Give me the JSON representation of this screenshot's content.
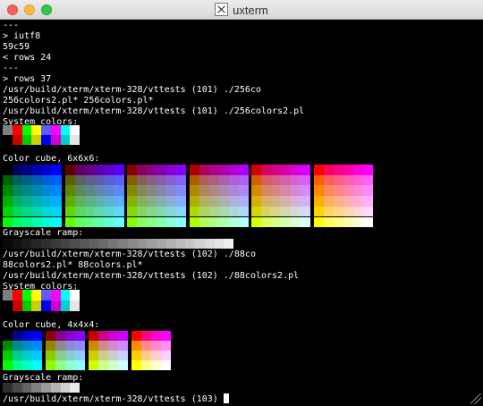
{
  "window": {
    "title": "uxterm"
  },
  "terminal": {
    "lines": [
      "---",
      "> iutf8",
      "59c59",
      "< rows 24",
      "---",
      "> rows 37",
      "/usr/build/xterm/xterm-328/vttests (101) ./256co",
      "256colors2.pl* 256colors.pl*",
      "/usr/build/xterm/xterm-328/vttests (101) ./256colors2.pl",
      "System colors:",
      "Color cube, 6x6x6:",
      "Grayscale ramp:",
      "/usr/build/xterm/xterm-328/vttests (102) ./88co",
      "88colors2.pl* 88colors.pl*",
      "/usr/build/xterm/xterm-328/vttests (102) ./88colors2.pl",
      "System colors:",
      "Color cube, 4x4x4:",
      "Grayscale ramp:",
      "/usr/build/xterm/xterm-328/vttests (103)"
    ]
  },
  "palette": {
    "system_colors": [
      "#000000",
      "#cd0000",
      "#00cd00",
      "#cdcd00",
      "#0000ee",
      "#cd00cd",
      "#00cdcd",
      "#e5e5e5",
      "#7f7f7f",
      "#ff0000",
      "#00ff00",
      "#ffff00",
      "#5c5cff",
      "#ff00ff",
      "#00ffff",
      "#ffffff"
    ],
    "cube_6_levels": [
      "#00",
      "#5f",
      "#87",
      "#af",
      "#d7",
      "#ff"
    ],
    "cube_4_levels": [
      "#00",
      "#8b",
      "#cd",
      "#ff"
    ],
    "grayscale_256_count": 24,
    "grayscale_88_count": 8
  }
}
